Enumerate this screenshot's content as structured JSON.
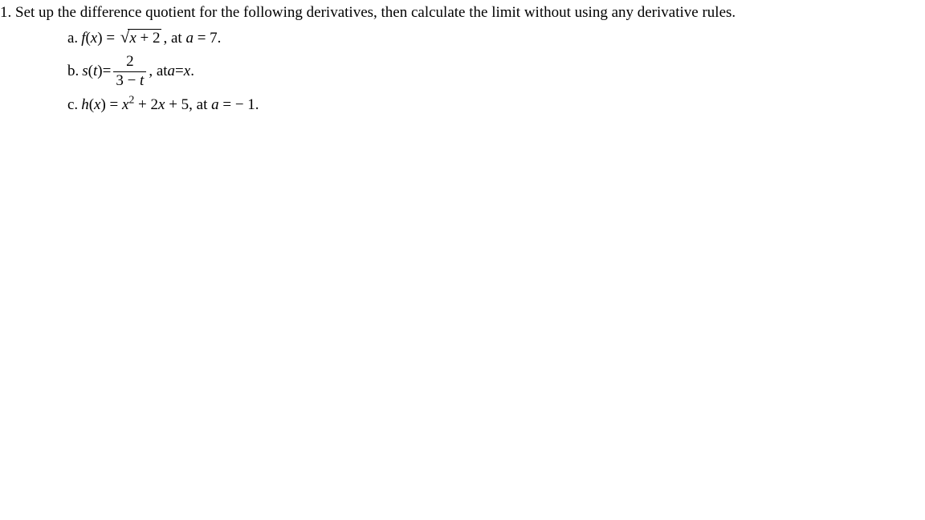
{
  "problem": {
    "number": "1.",
    "stem": "Set up the difference quotient for the following derivatives, then calculate the limit without using any derivative rules.",
    "parts": {
      "a": {
        "label": "a.",
        "func_lhs_name": "f",
        "func_lhs_arg": "x",
        "eq": " = ",
        "sqrt_x": "x",
        "sqrt_plus": " + 2",
        "tail1": ", at ",
        "a_letter": "a",
        "tail2": " = 7."
      },
      "b": {
        "label": "b.",
        "func_lhs_name": "s",
        "func_lhs_arg": "t",
        "eq": " = ",
        "numerator": "2",
        "den_left": "3 − ",
        "den_var": "t",
        "tail1": ", at ",
        "a_letter": "a",
        "eq2": " = ",
        "rhs_var": "x",
        "tail2": "."
      },
      "c": {
        "label": "c.",
        "func_lhs_name": "h",
        "func_lhs_arg": "x",
        "eq": " = ",
        "term1_var": "x",
        "term1_exp": "2",
        "mid": " + 2",
        "term2_var": "x",
        "mid2": " + 5, at ",
        "a_letter": "a",
        "tail": " = − 1."
      }
    }
  }
}
